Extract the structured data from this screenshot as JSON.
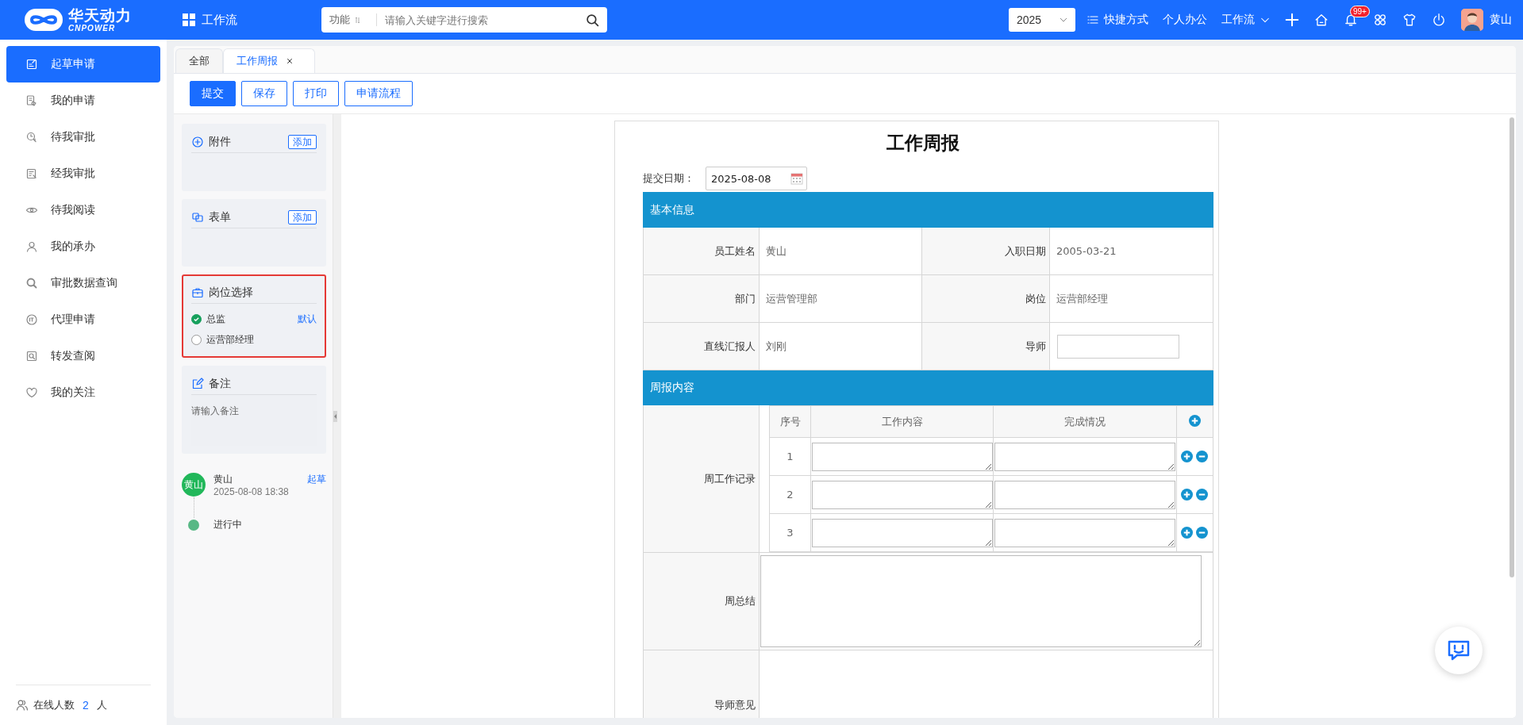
{
  "header": {
    "logo_cn": "华天动力",
    "logo_en": "CNPOWER",
    "module": "工作流",
    "search": {
      "scope": "功能",
      "placeholder": "请输入关键字进行搜索"
    },
    "year": "2025",
    "nav": [
      {
        "label": "快捷方式",
        "kind": "list"
      },
      {
        "label": "个人办公",
        "kind": "plain"
      },
      {
        "label": "工作流",
        "kind": "dropdown"
      }
    ],
    "badge": "99+",
    "user": "黄山"
  },
  "sidebar": {
    "items": [
      {
        "label": "起草申请",
        "selected": true
      },
      {
        "label": "我的申请",
        "selected": false
      },
      {
        "label": "待我审批",
        "selected": false
      },
      {
        "label": "经我审批",
        "selected": false
      },
      {
        "label": "待我阅读",
        "selected": false
      },
      {
        "label": "我的承办",
        "selected": false
      },
      {
        "label": "审批数据查询",
        "selected": false
      },
      {
        "label": "代理申请",
        "selected": false
      },
      {
        "label": "转发查阅",
        "selected": false
      },
      {
        "label": "我的关注",
        "selected": false
      }
    ],
    "online": {
      "label": "在线人数",
      "count": "2",
      "unit": "人"
    }
  },
  "tabs": [
    {
      "label": "全部",
      "selected": false
    },
    {
      "label": "工作周报",
      "selected": true
    }
  ],
  "toolbar": [
    {
      "label": "提交",
      "kind": "primary"
    },
    {
      "label": "保存",
      "kind": "outline"
    },
    {
      "label": "打印",
      "kind": "outline"
    },
    {
      "label": "申请流程",
      "kind": "outline"
    }
  ],
  "panels": [
    {
      "kind": "attachment",
      "title": "附件",
      "action": "添加",
      "highlighted": false
    },
    {
      "kind": "form",
      "title": "表单",
      "action": "添加",
      "highlighted": false
    },
    {
      "kind": "position",
      "title": "岗位选择",
      "highlighted": true,
      "options": [
        {
          "label": "总监",
          "selected": true,
          "note": "默认"
        },
        {
          "label": "运营部经理",
          "selected": false
        }
      ]
    },
    {
      "kind": "remark",
      "title": "备注",
      "placeholder": "请输入备注",
      "highlighted": false
    }
  ],
  "timeline": [
    {
      "kind": "person",
      "avatar": "黄山",
      "name": "黄山",
      "time": "2025-08-08 18:38",
      "action": "起草"
    },
    {
      "kind": "status",
      "label": "进行中"
    }
  ],
  "form": {
    "title": "工作周报",
    "date_label": "提交日期：",
    "date": "2025-08-08",
    "basic": {
      "header": "基本信息",
      "rows": [
        [
          {
            "label": "员工姓名",
            "kind": "text",
            "value": "黄山"
          },
          {
            "label": "入职日期",
            "kind": "text",
            "value": "2005-03-21"
          }
        ],
        [
          {
            "label": "部门",
            "kind": "text",
            "value": "运营管理部"
          },
          {
            "label": "岗位",
            "kind": "text",
            "value": "运营部经理"
          }
        ],
        [
          {
            "label": "直线汇报人",
            "kind": "text",
            "value": "刘刚"
          },
          {
            "label": "导师",
            "kind": "input"
          }
        ]
      ]
    },
    "weekly": {
      "header": "周报内容",
      "records_label": "周工作记录",
      "columns": [
        "序号",
        "工作内容",
        "完成情况"
      ],
      "rows": [
        "1",
        "2",
        "3"
      ],
      "summary_label": "周总结",
      "mentor_label": "导师意见"
    }
  }
}
